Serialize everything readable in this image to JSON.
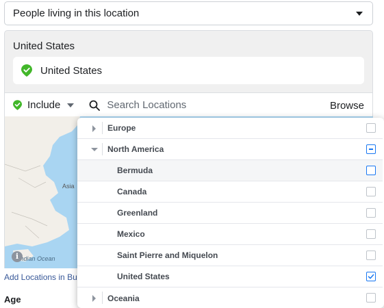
{
  "audience_select": {
    "value": "People living in this location"
  },
  "location_group": {
    "title": "United States",
    "chip_label": "United States"
  },
  "search_row": {
    "include_label": "Include",
    "search_placeholder": "Search Locations",
    "browse_label": "Browse"
  },
  "map": {
    "label_asia": "Asia",
    "label_ocean": "Indian Ocean",
    "info_glyph": "i"
  },
  "bulk_link": "Add Locations in Bulk",
  "age_heading": "Age",
  "dropdown": {
    "items": [
      {
        "label": "Europe",
        "level": 0,
        "expanded": false,
        "checkbox": "unchecked"
      },
      {
        "label": "North America",
        "level": 0,
        "expanded": true,
        "checkbox": "partial"
      },
      {
        "label": "Bermuda",
        "level": 1,
        "checkbox": "unchecked",
        "highlighted": true
      },
      {
        "label": "Canada",
        "level": 1,
        "checkbox": "unchecked"
      },
      {
        "label": "Greenland",
        "level": 1,
        "checkbox": "unchecked"
      },
      {
        "label": "Mexico",
        "level": 1,
        "checkbox": "unchecked"
      },
      {
        "label": "Saint Pierre and Miquelon",
        "level": 1,
        "checkbox": "unchecked"
      },
      {
        "label": "United States",
        "level": 1,
        "checkbox": "checked"
      },
      {
        "label": "Oceania",
        "level": 0,
        "expanded": false,
        "checkbox": "unchecked"
      }
    ]
  },
  "colors": {
    "accent": "#1877f2",
    "location_pin": "#42b72a",
    "map_water": "#a9d5f2",
    "map_land": "#f2efe9"
  }
}
